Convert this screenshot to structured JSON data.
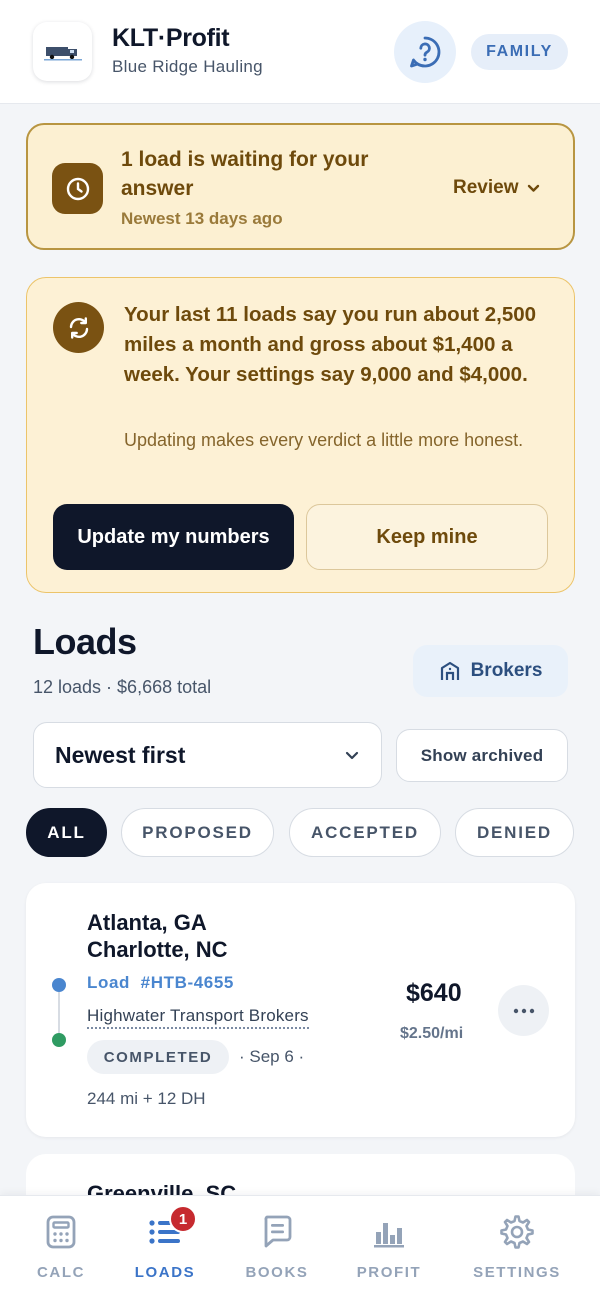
{
  "header": {
    "title": "KLT·Profit",
    "subtitle": "Blue Ridge Hauling",
    "help_icon": "help-circle-icon",
    "plan": "FAMILY"
  },
  "waiting": {
    "title": "1 load is waiting for your answer",
    "subtitle": "Newest 13 days ago",
    "action": "Review"
  },
  "numbers": {
    "message": "Your last 11 loads say you run about 2,500 miles a month and gross about $1,400 a week. Your settings say 9,000 and $4,000.",
    "detail": "Updating makes every verdict a little more honest.",
    "update_label": "Update my numbers",
    "keep_label": "Keep mine"
  },
  "loads": {
    "title": "Loads",
    "summary": "12 loads · $6,668 total",
    "brokers_label": "Brokers",
    "sort_value": "Newest first",
    "archived_label": "Show archived",
    "filters": [
      "ALL",
      "PROPOSED",
      "ACCEPTED",
      "DENIED"
    ],
    "active_filter": "ALL",
    "items": [
      {
        "origin": "Atlanta, GA",
        "destination": "Charlotte, NC",
        "load_id": "Load  #HTB-4655",
        "broker": "Highwater Transport Brokers",
        "status": "COMPLETED",
        "date_meta": "· Sep 6 ·",
        "miles": "244 mi + 12 DH",
        "price": "$640",
        "rate": "$2.50/mi"
      },
      {
        "origin": "Greenville, SC"
      }
    ]
  },
  "nav": {
    "items": [
      {
        "label": "CALC",
        "icon": "calculator-icon"
      },
      {
        "label": "LOADS",
        "icon": "list-icon",
        "badge": "1"
      },
      {
        "label": "BOOKS",
        "icon": "notes-icon"
      },
      {
        "label": "PROFIT",
        "icon": "bar-chart-icon"
      },
      {
        "label": "SETTINGS",
        "icon": "gear-icon"
      }
    ],
    "active": "LOADS"
  },
  "colors": {
    "accent": "#3b74c8",
    "warning_bg": "#fcf0d2",
    "warning_text": "#6e4a0c",
    "dark": "#0f172a",
    "badge": "#c62a2f"
  }
}
